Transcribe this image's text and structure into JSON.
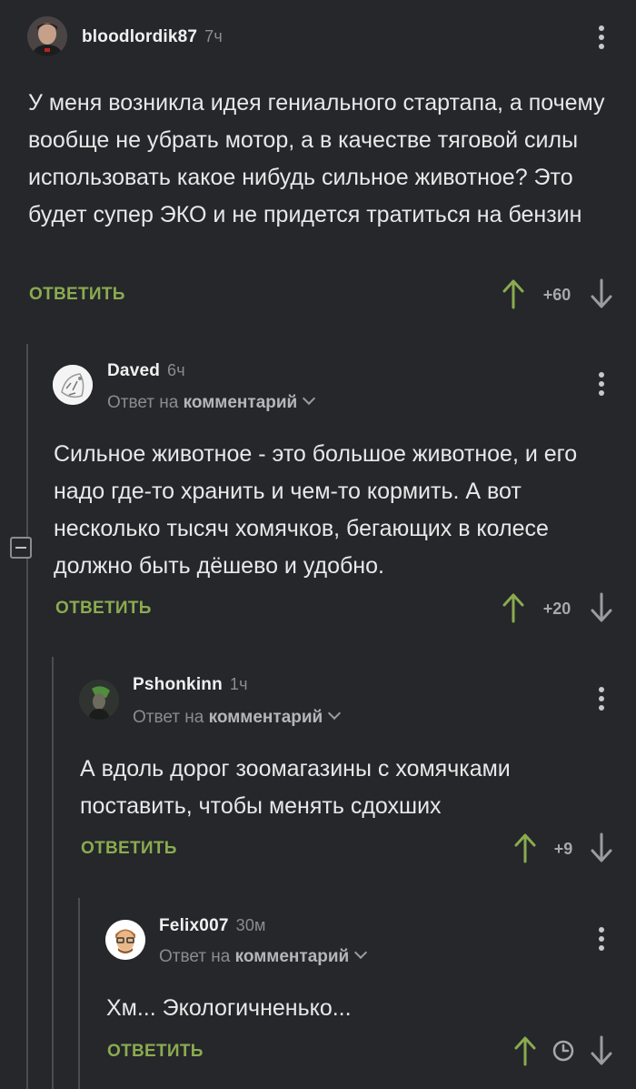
{
  "comments": [
    {
      "username": "bloodlordik87",
      "time": "7ч",
      "text": "У меня возникла идея гениального стартапа, а почему вообще не убрать мотор, а в качестве тяговой силы использовать какое нибудь сильное животное? Это будет супер ЭКО и не придется тратиться на бензин",
      "reply": "ОТВЕТИТЬ",
      "score": "+60"
    },
    {
      "username": "Daved",
      "time": "6ч",
      "reply_to_prefix": "Ответ на",
      "reply_to_target": "комментарий",
      "text": "Сильное животное - это большое животное, и его надо где-то хранить и чем-то кормить. А вот несколько тысяч хомячков, бегающих в колесе должно быть дёшево и удобно.",
      "reply": "ОТВЕТИТЬ",
      "score": "+20"
    },
    {
      "username": "Pshonkinn",
      "time": "1ч",
      "reply_to_prefix": "Ответ на",
      "reply_to_target": "комментарий",
      "text": "А вдоль дорог зоомагазины с хомячками поставить, чтобы менять сдохших",
      "reply": "ОТВЕТИТЬ",
      "score": "+9"
    },
    {
      "username": "Felix007",
      "time": "30м",
      "reply_to_prefix": "Ответ на",
      "reply_to_target": "комментарий",
      "text": "Хм... Экологичненько...",
      "reply": "ОТВЕТИТЬ",
      "score_icon": "clock-icon"
    }
  ],
  "colors": {
    "background": "#25272b",
    "accent_green": "#8bab4f",
    "upvote_arrow": "#8bab4f",
    "downvote_arrow": "#9a9ca0",
    "muted_text": "#8a8c90"
  }
}
